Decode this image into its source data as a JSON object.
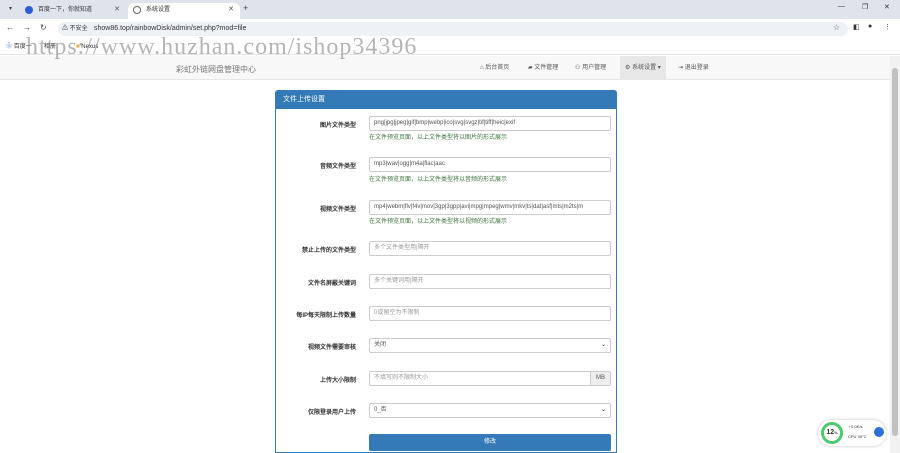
{
  "browser": {
    "tabs": [
      {
        "label": "百度一下，你就知道"
      },
      {
        "label": "系统设置"
      }
    ],
    "new_tab": "+",
    "insecure_label": "不安全",
    "url": "show86.top/rainbowDisk/admin/set.php?mod=file",
    "bookmarks": [
      "百度一",
      "相册",
      "Nexus"
    ]
  },
  "watermark": "https://www.huzhan.com/ishop34396",
  "navbar": {
    "brand": "彩虹外链网盘管理中心",
    "items": [
      {
        "label": "后台首页",
        "icon": "home-icon"
      },
      {
        "label": "文件管理",
        "icon": "folder-icon"
      },
      {
        "label": "用户管理",
        "icon": "users-icon"
      },
      {
        "label": "系统设置",
        "icon": "gear-icon"
      },
      {
        "label": "退出登录",
        "icon": "logout-icon"
      }
    ]
  },
  "panel": {
    "title": "文件上传设置",
    "rows": [
      {
        "label": "图片文件类型",
        "value": "png|jpg|jpeg|gif|bmp|webp|ico|svg|svgz|tif|tiff|heic|exif",
        "placeholder": "",
        "help": "在文件预览页面，以上文件类型将以图片的形式展示"
      },
      {
        "label": "音频文件类型",
        "value": "mp3|wav|ogg|m4a|flac|aac",
        "placeholder": "",
        "help": "在文件预览页面，以上文件类型将以音频的形式展示"
      },
      {
        "label": "视频文件类型",
        "value": "mp4|webm|flv|f4v|mov|3gp|3gpp|avi|mpg|mpeg|wmv|mkv|ts|dat|asf|mts|m2ts|m",
        "placeholder": "",
        "help": "在文件预览页面，以上文件类型将以视频的形式展示"
      },
      {
        "label": "禁止上传的文件类型",
        "value": "",
        "placeholder": "多个文件类型用|隔开",
        "help": ""
      },
      {
        "label": "文件名屏蔽关键词",
        "value": "",
        "placeholder": "多个关键词用|隔开",
        "help": ""
      },
      {
        "label": "每IP每天限制上传数量",
        "value": "",
        "placeholder": "0或留空为不限制",
        "help": ""
      },
      {
        "label": "视频文件需要审核",
        "value": "关闭",
        "placeholder": "",
        "help": ""
      },
      {
        "label": "上传大小限制",
        "value": "",
        "placeholder": "不填写则不限制大小",
        "addon": "MB",
        "help": ""
      },
      {
        "label": "仅限登录用户上传",
        "value": "0_否",
        "placeholder": "",
        "help": ""
      }
    ],
    "submit_label": "修改"
  },
  "cpu_widget": {
    "percent": "12",
    "percent_unit": "%",
    "speed": "↑ 0.0K/s",
    "temp": "CPU 39°C"
  },
  "colors": {
    "primary": "#337ab7",
    "help": "#3c763d",
    "watermark": "#787878"
  }
}
